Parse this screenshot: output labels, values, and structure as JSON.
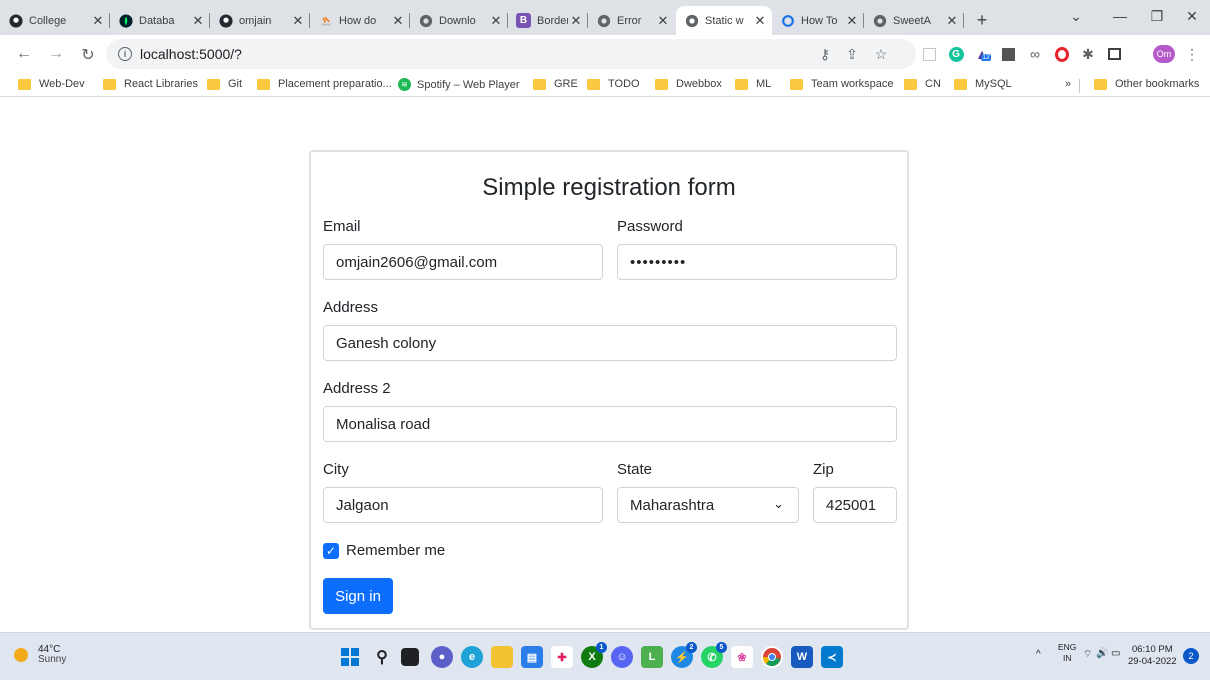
{
  "browser": {
    "tabs": [
      {
        "title": "College",
        "icon": "github-icon"
      },
      {
        "title": "Databa",
        "icon": "mongodb-icon"
      },
      {
        "title": "omjain",
        "icon": "github-icon"
      },
      {
        "title": "How do",
        "icon": "stackoverflow-icon"
      },
      {
        "title": "Downlo",
        "icon": "globe-icon"
      },
      {
        "title": "Borders",
        "icon": "bootstrap-icon"
      },
      {
        "title": "Error",
        "icon": "globe-icon"
      },
      {
        "title": "Static w",
        "icon": "globe-icon",
        "active": true
      },
      {
        "title": "How To",
        "icon": "refresh-icon"
      },
      {
        "title": "SweetA",
        "icon": "globe-icon"
      }
    ],
    "url": "localhost:5000/?",
    "profile_initials": "Om",
    "extension_badge": "12",
    "bookmarks": [
      {
        "label": "Web-Dev",
        "icon": "folder-icon"
      },
      {
        "label": "React Libraries",
        "icon": "folder-icon"
      },
      {
        "label": "Git",
        "icon": "folder-icon"
      },
      {
        "label": "Placement preparatio...",
        "icon": "folder-icon"
      },
      {
        "label": "Spotify – Web Player",
        "icon": "spotify-icon"
      },
      {
        "label": "GRE",
        "icon": "folder-icon"
      },
      {
        "label": "TODO",
        "icon": "folder-icon"
      },
      {
        "label": "Dwebbox",
        "icon": "folder-icon"
      },
      {
        "label": "ML",
        "icon": "folder-icon"
      },
      {
        "label": "Team workspace",
        "icon": "folder-icon"
      },
      {
        "label": "CN",
        "icon": "folder-icon"
      },
      {
        "label": "MySQL",
        "icon": "folder-icon"
      }
    ],
    "bookmarks_overflow": "»",
    "other_bookmarks": "Other bookmarks"
  },
  "form": {
    "title": "Simple registration form",
    "email_label": "Email",
    "email_value": "omjain2606@gmail.com",
    "password_label": "Password",
    "password_value": "•••••••••",
    "address_label": "Address",
    "address_value": "Ganesh colony",
    "address2_label": "Address 2",
    "address2_value": "Monalisa road",
    "city_label": "City",
    "city_value": "Jalgaon",
    "state_label": "State",
    "state_value": "Maharashtra",
    "zip_label": "Zip",
    "zip_value": "425001",
    "remember_label": "Remember me",
    "remember_checked": true,
    "submit_label": "Sign in"
  },
  "taskbar": {
    "weather_temp": "44°C",
    "weather_cond": "Sunny",
    "lang": "ENG",
    "region": "IN",
    "time": "06:10 PM",
    "date": "29-04-2022",
    "notification_count": "2",
    "badges": {
      "xbox": "1",
      "messenger": "2",
      "whatsapp": "5"
    }
  },
  "colors": {
    "primary": "#0d6efd",
    "chrome_bg": "#dee1e6",
    "taskbar_bg": "#dfe6f0"
  }
}
